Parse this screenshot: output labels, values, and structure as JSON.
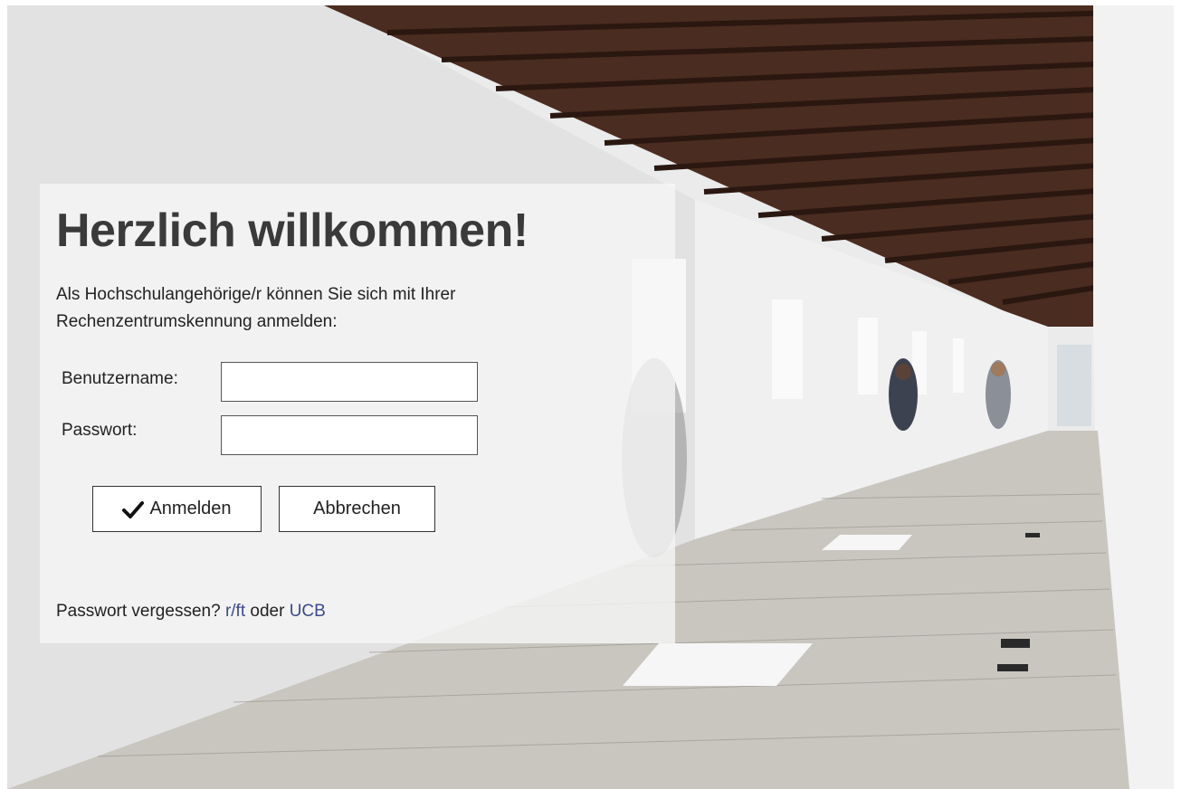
{
  "login": {
    "title": "Herzlich willkommen!",
    "intro": "Als Hochschulangehörige/r können Sie sich mit Ihrer Rechenzentrumskennung anmelden:",
    "username_label": "Benutzername:",
    "username_value": "",
    "password_label": "Passwort:",
    "password_value": "",
    "login_button": "Anmelden",
    "cancel_button": "Abbrechen",
    "forgot_prefix": "Passwort vergessen?",
    "forgot_link_1": "r/ft",
    "forgot_conjunction": "oder",
    "forgot_link_2": "UCB"
  },
  "icons": {
    "login_button_icon": "check-icon"
  },
  "colors": {
    "link": "#3b4a8c",
    "title": "#3a3a3a",
    "panel_bg": "#f6f6f6"
  }
}
